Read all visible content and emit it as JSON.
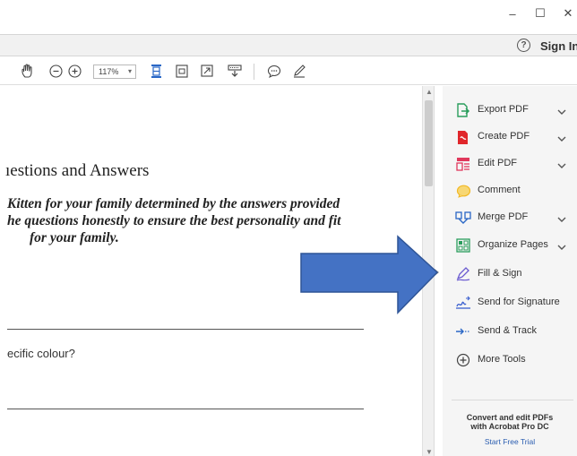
{
  "window": {
    "minimize_glyph": "–",
    "maximize_glyph": "☐",
    "close_glyph": "✕"
  },
  "menubar": {
    "help_glyph": "?",
    "sign_in": "Sign In"
  },
  "toolbar": {
    "zoom_value": "117%",
    "zoom_caret": "▾",
    "icons": [
      "hand-icon",
      "zoom-out-icon",
      "zoom-in-icon",
      "fit-width-icon",
      "rotate-icon",
      "full-screen-icon",
      "read-mode-icon",
      "comment-icon",
      "pen-icon"
    ]
  },
  "document": {
    "heading": "ıestions and Answers",
    "intro_lines": [
      "Kitten for your family determined by the answers provided",
      "he questions honestly to ensure the best personality and fit",
      "for your family."
    ],
    "question": "ecific colour?"
  },
  "tools_pane": {
    "items": [
      {
        "label": "Export PDF",
        "icon": "export-pdf-icon",
        "color": "#2a9d5c",
        "has_chevron": true
      },
      {
        "label": "Create PDF",
        "icon": "create-pdf-icon",
        "color": "#e0262b",
        "has_chevron": true
      },
      {
        "label": "Edit PDF",
        "icon": "edit-pdf-icon",
        "color": "#e0385c",
        "has_chevron": true
      },
      {
        "label": "Comment",
        "icon": "comment-bubble-icon",
        "color": "#f2b825",
        "has_chevron": false
      },
      {
        "label": "Merge PDF",
        "icon": "merge-pdf-icon",
        "color": "#2a67c6",
        "has_chevron": true
      },
      {
        "label": "Organize Pages",
        "icon": "organize-pages-icon",
        "color": "#2a9d5c",
        "has_chevron": true
      },
      {
        "label": "Fill & Sign",
        "icon": "fill-sign-icon",
        "color": "#6a5ad0",
        "has_chevron": false
      },
      {
        "label": "Send for Signature",
        "icon": "send-signature-icon",
        "color": "#3a5fcf",
        "has_chevron": false
      },
      {
        "label": "Send & Track",
        "icon": "send-track-icon",
        "color": "#2a67c6",
        "has_chevron": false
      },
      {
        "label": "More Tools",
        "icon": "more-tools-icon",
        "color": "#444444",
        "has_chevron": false
      }
    ],
    "promo": {
      "line1": "Convert and edit PDFs",
      "line2": "with Acrobat Pro DC",
      "link": "Start Free Trial"
    }
  },
  "colors": {
    "annotation_arrow": "#4472c4",
    "annotation_arrow_border": "#2f5597"
  }
}
